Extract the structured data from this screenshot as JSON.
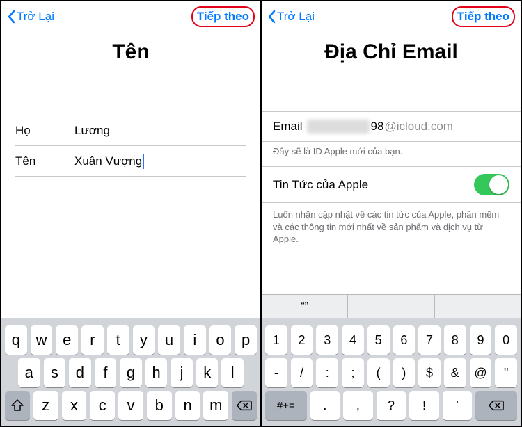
{
  "left": {
    "nav": {
      "back": "Trở Lại",
      "next": "Tiếp theo"
    },
    "title": "Tên",
    "fields": {
      "lastname_label": "Họ",
      "lastname_value": "Lương",
      "firstname_label": "Tên",
      "firstname_value": "Xuân Vượng"
    },
    "keyboard": {
      "row1": [
        "q",
        "w",
        "e",
        "r",
        "t",
        "y",
        "u",
        "i",
        "o",
        "p"
      ],
      "row2": [
        "a",
        "s",
        "d",
        "f",
        "g",
        "h",
        "j",
        "k",
        "l"
      ],
      "row3_shift": "⇧",
      "row3": [
        "z",
        "x",
        "c",
        "v",
        "b",
        "n",
        "m"
      ],
      "row3_back": "⌫"
    }
  },
  "right": {
    "nav": {
      "back": "Trở Lại",
      "next": "Tiếp theo"
    },
    "title": "Địa Chỉ Email",
    "email": {
      "label": "Email",
      "visible_suffix": "98",
      "domain": "@icloud.com",
      "caption": "Đây sẽ là ID Apple mới của bạn."
    },
    "toggle": {
      "label": "Tin Tức của Apple",
      "on": true,
      "desc": "Luôn nhận cập nhật về các tin tức của Apple, phần mềm và các thông tin mới nhất về sản phẩm và dịch vụ từ Apple."
    },
    "keyboard": {
      "row1": [
        "1",
        "2",
        "3",
        "4",
        "5",
        "6",
        "7",
        "8",
        "9",
        "0"
      ],
      "row2": [
        "-",
        "/",
        ":",
        ";",
        "(",
        ")",
        "$",
        "&",
        "@",
        "\""
      ],
      "row3_sym": "#+=",
      "row3": [
        ".",
        ",",
        "?",
        "!",
        "'"
      ],
      "row3_back": "⌫",
      "suggestions": [
        "“”",
        "",
        ""
      ]
    }
  }
}
